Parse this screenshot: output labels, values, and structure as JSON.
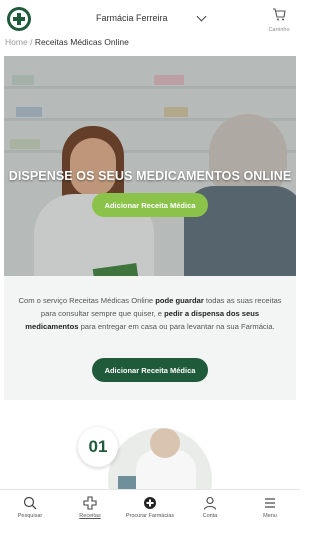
{
  "header": {
    "store_name": "Farmácia Ferreira",
    "cart_label": "Carrinho",
    "logo_icon": "pharmacy-cross-icon",
    "colors": {
      "brand": "#1f5a3a"
    }
  },
  "breadcrumb": {
    "home": "Home",
    "separator": "/",
    "current": "Receitas Médicas Online"
  },
  "hero": {
    "title": "DISPENSE OS SEUS MEDICAMENTOS ONLINE",
    "button_label": "Adicionar Receita Médica",
    "button_color": "#8bc34a"
  },
  "description": {
    "part1": "Com o serviço Receitas Médicas Online ",
    "bold1": "pode guardar",
    "part2": " todas as suas receitas para consultar sempre que quiser, e ",
    "bold2": "pedir a dispensa dos seus medicamentos",
    "part3": " para entregar em casa ou para levantar na sua Farmácia.",
    "button_label": "Adicionar Receita Médica",
    "button_color": "#1f5a3a"
  },
  "step": {
    "number": "01"
  },
  "bottom_nav": {
    "items": [
      {
        "label": "Pesquisar",
        "icon": "search-icon"
      },
      {
        "label": "Receitas",
        "icon": "pharmacy-cross-icon",
        "active": true
      },
      {
        "label": "Procurar Farmácias",
        "icon": "location-cross-icon"
      },
      {
        "label": "Conta",
        "icon": "user-icon"
      },
      {
        "label": "Menu",
        "icon": "hamburger-menu-icon"
      }
    ]
  }
}
